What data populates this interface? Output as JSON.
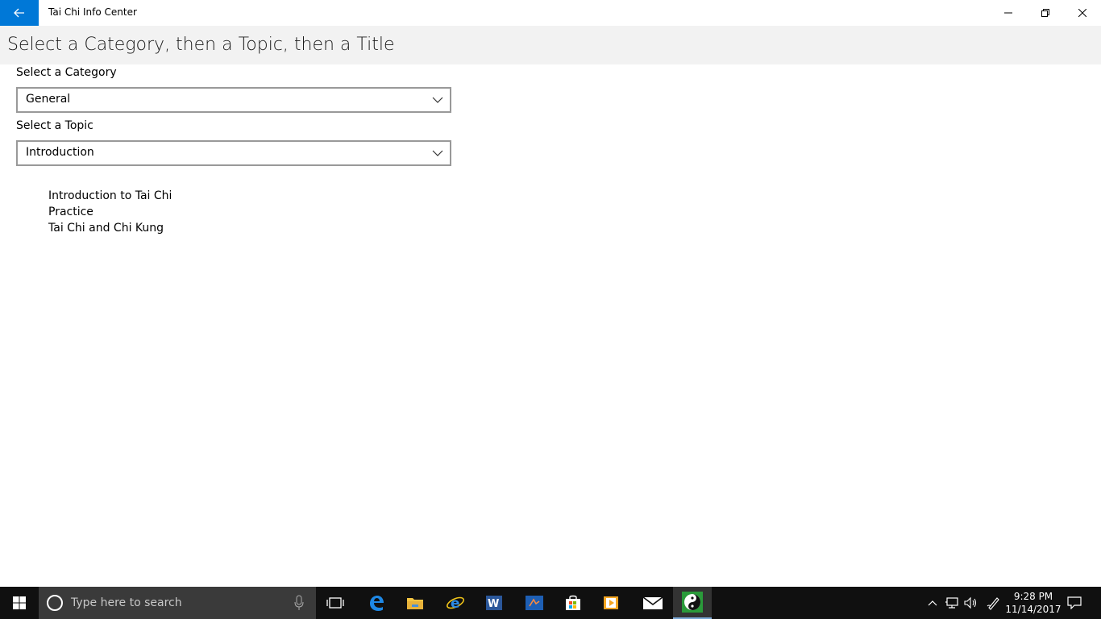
{
  "window": {
    "title": "Tai Chi Info Center"
  },
  "header": {
    "title": "Select a Category, then a Topic, then a Title"
  },
  "form": {
    "category_label": "Select a Category",
    "category_value": "General",
    "topic_label": "Select a Topic",
    "topic_value": "Introduction"
  },
  "titles": [
    "Introduction to Tai Chi",
    "Practice",
    "Tai Chi and Chi Kung"
  ],
  "taskbar": {
    "search_placeholder": "Type here to search",
    "pinned": [
      "task-view",
      "edge",
      "file-explorer",
      "internet-explorer",
      "word",
      "remote-desktop",
      "store",
      "media-player",
      "mail",
      "tai-chi-app"
    ],
    "time": "9:28 PM",
    "date": "11/14/2017"
  },
  "colors": {
    "accent": "#0078d7",
    "header_bg": "#f2f2f2",
    "taskbar_bg": "#101010",
    "search_bg": "#3a3a3a"
  }
}
